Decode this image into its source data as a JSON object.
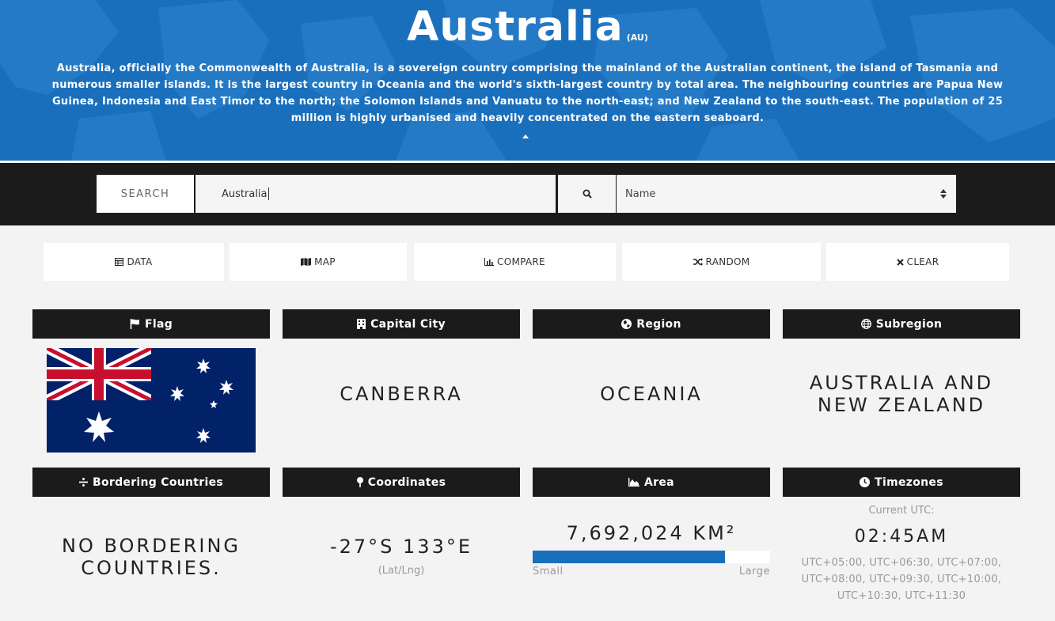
{
  "header": {
    "title": "Australia",
    "code": "(AU)",
    "description": "Australia, officially the Commonwealth of Australia, is a sovereign country comprising the mainland of the Australian continent, the island of Tasmania and numerous smaller islands. It is the largest country in Oceania and the world's sixth-largest country by total area. The neighbouring countries are Papua New Guinea, Indonesia and East Timor to the north; the Solomon Islands and Vanuatu to the north-east; and New Zealand to the south-east. The population of 25 million is highly urbanised and heavily concentrated on the eastern seaboard.",
    "bg_color": "#1a6fbd"
  },
  "search": {
    "label": "SEARCH",
    "value": "Australia",
    "icon": "search-icon",
    "select_value": "Name"
  },
  "actions": [
    {
      "label": "DATA",
      "icon": "table-icon"
    },
    {
      "label": "MAP",
      "icon": "map-icon"
    },
    {
      "label": "COMPARE",
      "icon": "bar-chart-icon"
    },
    {
      "label": "RANDOM",
      "icon": "shuffle-icon"
    },
    {
      "label": "CLEAR",
      "icon": "close-icon"
    }
  ],
  "cards": {
    "flag": {
      "title": "Flag",
      "icon": "flag-icon"
    },
    "capital": {
      "title": "Capital City",
      "icon": "building-icon",
      "value": "CANBERRA"
    },
    "region": {
      "title": "Region",
      "icon": "globe-icon",
      "value": "OCEANIA"
    },
    "subregion": {
      "title": "Subregion",
      "icon": "globe-grid-icon",
      "value": "AUSTRALIA AND NEW ZEALAND"
    },
    "borders": {
      "title": "Bordering Countries",
      "icon": "divide-icon",
      "value": "NO BORDERING COUNTRIES."
    },
    "coords": {
      "title": "Coordinates",
      "icon": "pin-icon",
      "value": "-27°S 133°E",
      "sub": "(Lat/Lng)"
    },
    "area": {
      "title": "Area",
      "icon": "area-chart-icon",
      "value": "7,692,024 km²",
      "fraction": 0.81,
      "min_label": "Small",
      "max_label": "Large",
      "bar_color": "#1a6fbd"
    },
    "timezones": {
      "title": "Timezones",
      "icon": "clock-icon",
      "current_label": "Current UTC:",
      "current_time": "02:45AM",
      "list": "UTC+05:00, UTC+06:30, UTC+07:00, UTC+08:00, UTC+09:30, UTC+10:00, UTC+10:30, UTC+11:30"
    }
  }
}
